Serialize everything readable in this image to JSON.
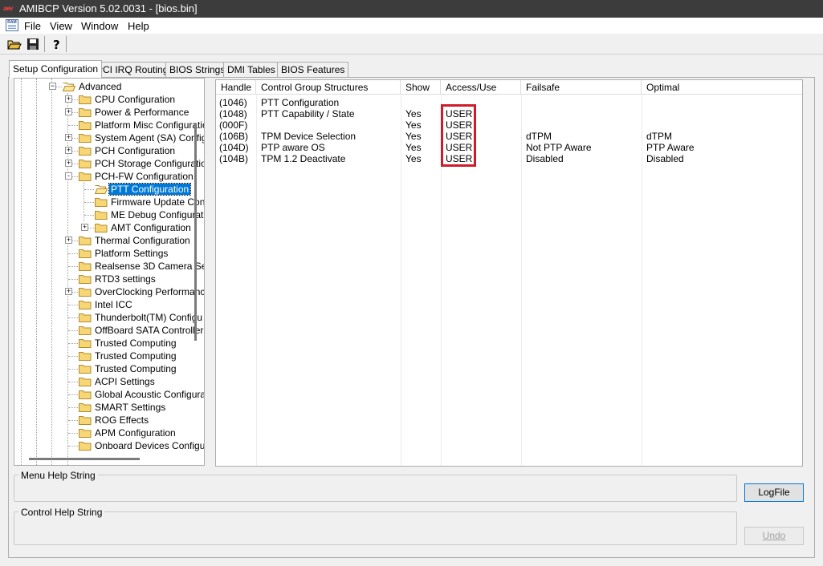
{
  "window": {
    "title": "AMIBCP Version 5.02.0031 - [bios.bin]",
    "logo_text": "aev"
  },
  "menu": {
    "doc_icon_text": "RAM",
    "items": [
      "File",
      "View",
      "Window",
      "Help"
    ]
  },
  "toolbar": {
    "buttons": [
      "open-icon",
      "save-icon",
      "help-icon"
    ]
  },
  "tabs": [
    {
      "label": "Setup Configuration",
      "active": true
    },
    {
      "label": "PCI IRQ Routing",
      "active": false
    },
    {
      "label": "BIOS Strings",
      "active": false
    },
    {
      "label": "DMI Tables",
      "active": false
    },
    {
      "label": "BIOS Features",
      "active": false
    }
  ],
  "tree": {
    "items": [
      {
        "label": "Advanced",
        "expanded": true
      },
      {
        "label": "CPU Configuration",
        "expander": "+"
      },
      {
        "label": "Power & Performance",
        "expander": "+"
      },
      {
        "label": "Platform Misc Configuratio"
      },
      {
        "label": "System Agent (SA) Config",
        "expander": "+"
      },
      {
        "label": "PCH Configuration",
        "expander": "+"
      },
      {
        "label": "PCH Storage Configuratio",
        "expander": "+"
      },
      {
        "label": "PCH-FW Configuration",
        "expander": "-"
      },
      {
        "label": "PTT Configuration",
        "selected": true
      },
      {
        "label": "Firmware Update Con"
      },
      {
        "label": "ME Debug Configurat"
      },
      {
        "label": "AMT Configuration",
        "expander": "+"
      },
      {
        "label": "Thermal Configuration",
        "expander": "+"
      },
      {
        "label": "Platform Settings"
      },
      {
        "label": "Realsense 3D Camera Se"
      },
      {
        "label": "RTD3 settings"
      },
      {
        "label": "OverClocking Performanc",
        "expander": "+"
      },
      {
        "label": "Intel ICC"
      },
      {
        "label": "Thunderbolt(TM) Configu"
      },
      {
        "label": "OffBoard SATA Controller"
      },
      {
        "label": "Trusted Computing"
      },
      {
        "label": "Trusted Computing"
      },
      {
        "label": "Trusted Computing"
      },
      {
        "label": "ACPI Settings"
      },
      {
        "label": "Global Acoustic Configura"
      },
      {
        "label": "SMART Settings"
      },
      {
        "label": "ROG Effects"
      },
      {
        "label": "APM Configuration"
      },
      {
        "label": "Onboard Devices Configu"
      }
    ]
  },
  "grid": {
    "columns": [
      "Handle",
      "Control Group Structures",
      "Show",
      "Access/Use",
      "Failsafe",
      "Optimal"
    ],
    "rows": [
      [
        "(1046)",
        "PTT Configuration",
        "",
        "",
        "",
        ""
      ],
      [
        "(1048)",
        "PTT Capability / State",
        "Yes",
        "USER",
        "",
        ""
      ],
      [
        "(000F)",
        "",
        "Yes",
        "USER",
        "",
        ""
      ],
      [
        "(106B)",
        "TPM Device Selection",
        "Yes",
        "USER",
        "dTPM",
        "dTPM"
      ],
      [
        "(104D)",
        "PTP aware OS",
        "Yes",
        "USER",
        "Not PTP Aware",
        "PTP Aware"
      ],
      [
        "(104B)",
        "TPM 1.2 Deactivate",
        "Yes",
        "USER",
        "Disabled",
        "Disabled"
      ]
    ],
    "highlight_color": "#d11a2a"
  },
  "help": {
    "menu_help_label": "Menu Help String",
    "control_help_label": "Control Help String"
  },
  "buttons": {
    "logfile": "LogFile",
    "undo": "Undo"
  }
}
